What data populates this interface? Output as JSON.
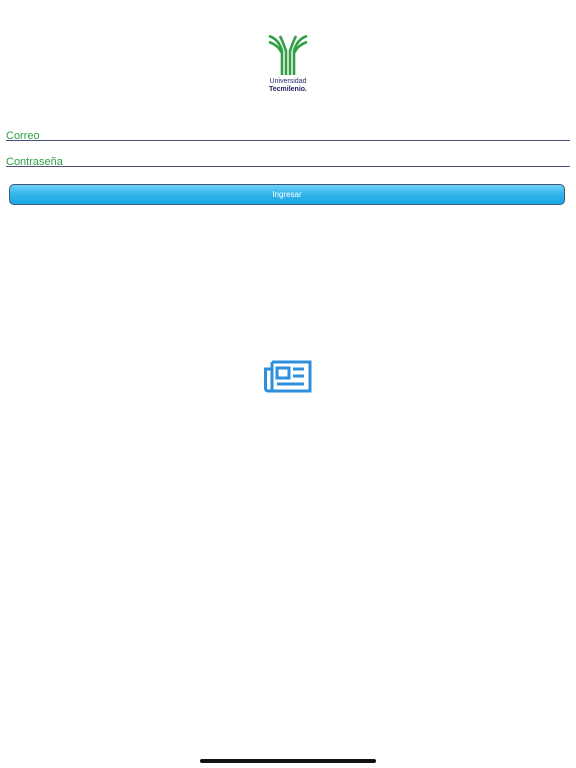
{
  "logo": {
    "line1": "Universidad",
    "line2": "Tecmilenio."
  },
  "form": {
    "email_placeholder": "Correo",
    "password_placeholder": "Contraseña",
    "submit_label": "Ingresar"
  },
  "icons": {
    "center": "newspaper-icon"
  },
  "colors": {
    "brand_green": "#2fa044",
    "brand_navy": "#23235f",
    "button_blue": "#2fb4ea",
    "icon_blue": "#2e8fdc"
  }
}
